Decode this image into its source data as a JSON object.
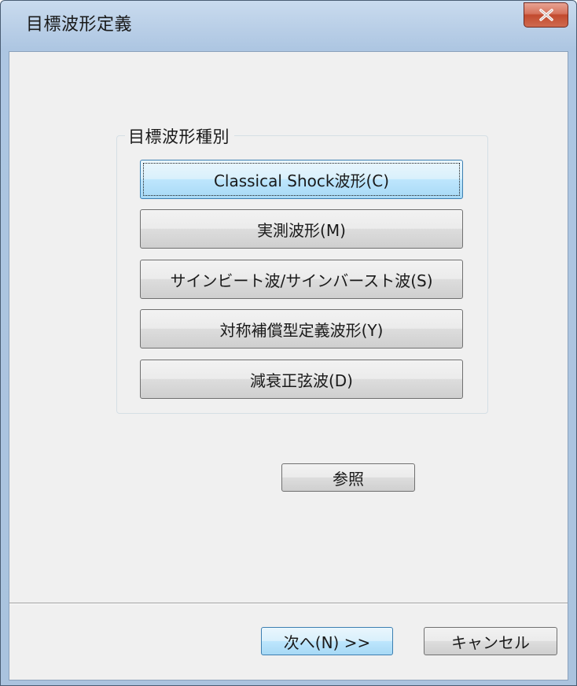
{
  "window": {
    "title": "目標波形定義"
  },
  "group": {
    "title": "目標波形種別",
    "buttons": [
      {
        "label": "Classical Shock波形(C)"
      },
      {
        "label": "実測波形(M)"
      },
      {
        "label": "サインビート波/サインバースト波(S)"
      },
      {
        "label": "対称補償型定義波形(Y)"
      },
      {
        "label": "減衰正弦波(D)"
      }
    ]
  },
  "reference_button": {
    "label": "参照"
  },
  "footer": {
    "next_label": "次へ(N) >>",
    "cancel_label": "キャンセル"
  }
}
